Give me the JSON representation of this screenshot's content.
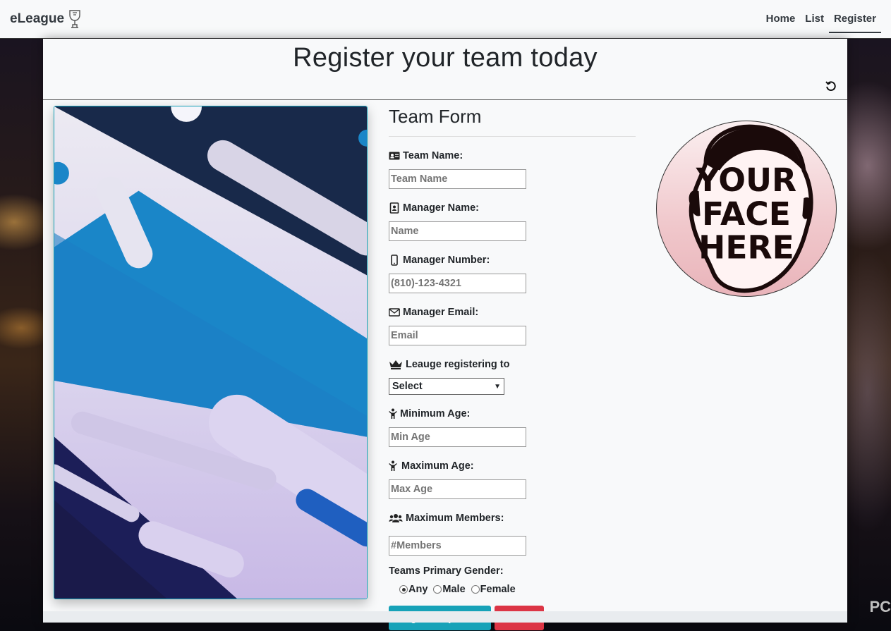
{
  "navbar": {
    "brand": "eLeague",
    "links": [
      {
        "label": "Home",
        "active": false
      },
      {
        "label": "List",
        "active": false
      },
      {
        "label": "Register",
        "active": true
      }
    ]
  },
  "page": {
    "title": "Register your team today"
  },
  "form": {
    "title": "Team Form",
    "team_name": {
      "label": "Team Name:",
      "placeholder": "Team Name",
      "icon": "id-card-icon"
    },
    "manager_name": {
      "label": "Manager Name:",
      "placeholder": "Name",
      "icon": "address-book-icon"
    },
    "manager_number": {
      "label": "Manager Number:",
      "placeholder": "(810)-123-4321",
      "icon": "mobile-phone-icon"
    },
    "manager_email": {
      "label": "Manager Email:",
      "placeholder": "Email",
      "icon": "envelope-icon"
    },
    "league": {
      "label": "Leauge registering to",
      "selected": "Select",
      "icon": "crown-icon"
    },
    "min_age": {
      "label": "Minimum Age:",
      "placeholder": "Min Age",
      "icon": "child-icon"
    },
    "max_age": {
      "label": "Maximum Age:",
      "placeholder": "Max Age",
      "icon": "child-icon"
    },
    "max_members": {
      "label": "Maximum Members:",
      "placeholder": "#Members",
      "icon": "users-icon"
    },
    "gender": {
      "label": "Teams Primary Gender:",
      "options": [
        {
          "label": "Any",
          "checked": true
        },
        {
          "label": "Male",
          "checked": false
        },
        {
          "label": "Female",
          "checked": false
        }
      ]
    },
    "submit_label": "Register my Team",
    "cancel_label": "Cancel"
  },
  "colors": {
    "primary_button": "#17a2b8",
    "danger_button": "#dc3545",
    "panel_background": "#f8f9fa"
  },
  "corner_text": "PC"
}
